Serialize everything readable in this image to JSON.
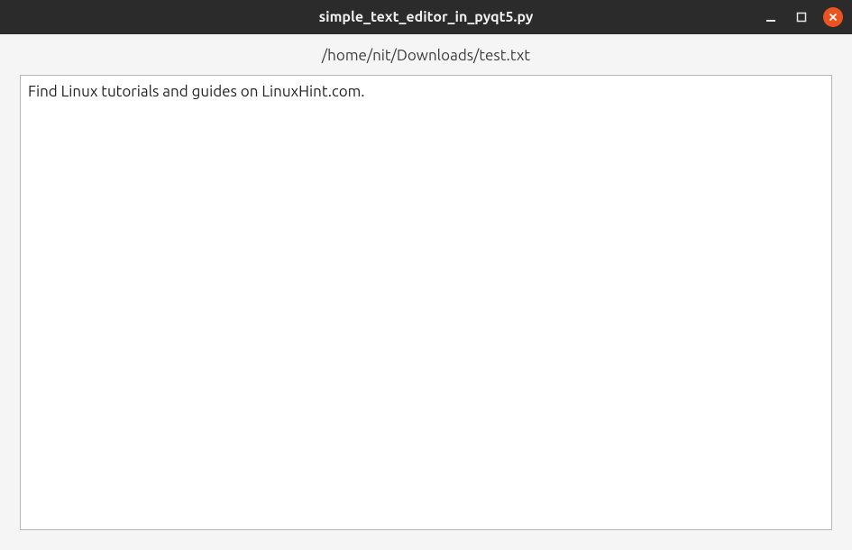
{
  "titlebar": {
    "title": "simple_text_editor_in_pyqt5.py"
  },
  "content": {
    "file_path": "/home/nit/Downloads/test.txt",
    "editor_text": "Find Linux tutorials and guides on LinuxHint.com."
  },
  "colors": {
    "titlebar_bg": "#2b2b2b",
    "close_button": "#e95420",
    "content_bg": "#f5f5f5",
    "editor_border": "#b8b8b8"
  }
}
